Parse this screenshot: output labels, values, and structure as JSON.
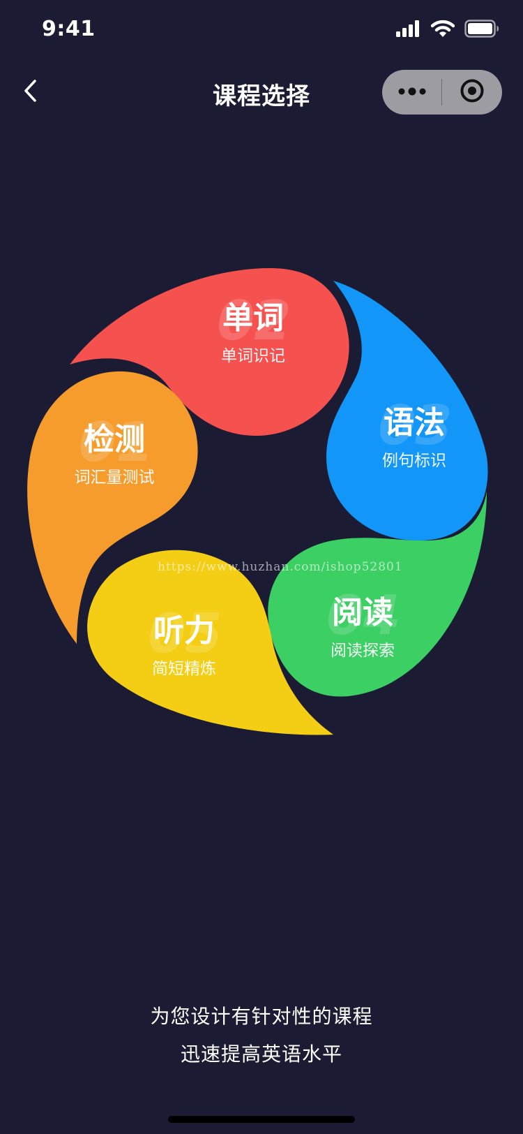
{
  "status_bar": {
    "time": "9:41",
    "icons": [
      "cellular-signal-icon",
      "wifi-icon",
      "battery-icon"
    ]
  },
  "nav": {
    "back_icon": "chevron-left-icon",
    "title": "课程选择",
    "capsule": {
      "more_icon": "more-dots-icon",
      "close_icon": "target-circle-icon"
    }
  },
  "petals": [
    {
      "id": "words",
      "title": "单词",
      "subtitle": "单词识记",
      "number": "02",
      "color": "#f5514f"
    },
    {
      "id": "grammar",
      "title": "语法",
      "subtitle": "例句标识",
      "number": "03",
      "color": "#1296f7"
    },
    {
      "id": "reading",
      "title": "阅读",
      "subtitle": "阅读探索",
      "number": "04",
      "color": "#3ccf63"
    },
    {
      "id": "listening",
      "title": "听力",
      "subtitle": "简短精炼",
      "number": "05",
      "color": "#f4ce14"
    },
    {
      "id": "test",
      "title": "检测",
      "subtitle": "词汇量测试",
      "number": "01",
      "color": "#f59c2c"
    }
  ],
  "watermark": "https://www.huzhan.com/ishop52801",
  "slogan": {
    "line1": "为您设计有针对性的课程",
    "line2": "迅速提高英语水平"
  },
  "colors": {
    "background": "#1b1c33",
    "capsule": "#9c9ca2"
  }
}
